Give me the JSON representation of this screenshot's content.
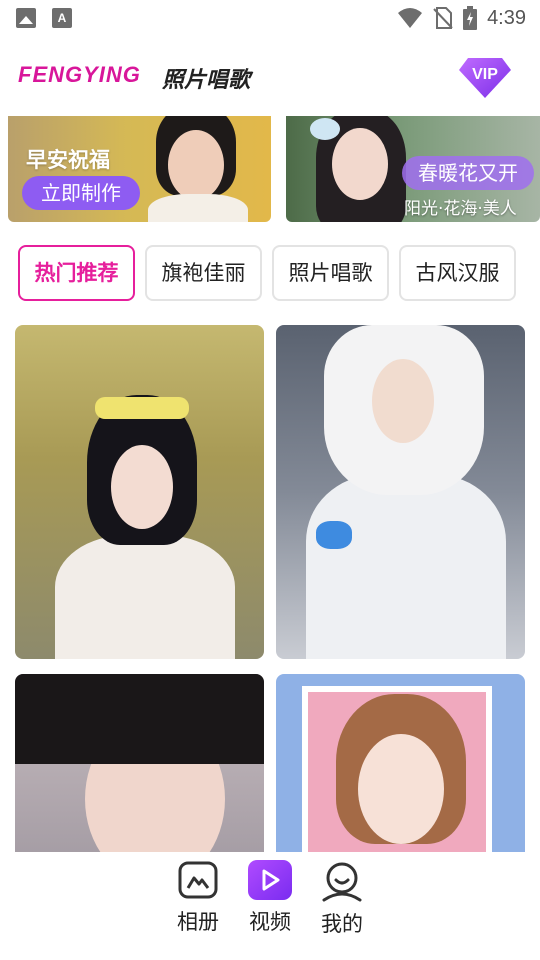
{
  "status_bar": {
    "time": "4:39",
    "left_icons": [
      "gallery-icon",
      "a-letter-icon"
    ],
    "right_icons": [
      "wifi-icon",
      "no-sim-icon",
      "battery-icon"
    ]
  },
  "header": {
    "brand": "FENGYING",
    "title": "照片唱歌",
    "vip_badge": "VIP",
    "brand_color": "#d8169a"
  },
  "banners": [
    {
      "title": "早安祝福",
      "button": "立即制作"
    },
    {
      "title": "春暖花又开",
      "subtitle": "阳光·花海·美人"
    }
  ],
  "tabs": [
    {
      "label": "热门推荐",
      "active": true
    },
    {
      "label": "旗袍佳丽",
      "active": false
    },
    {
      "label": "照片唱歌",
      "active": false
    },
    {
      "label": "古风汉服",
      "active": false
    }
  ],
  "accent_color": "#e61f9c",
  "grid": [
    {
      "kind": "portrait-hanfu-flowers"
    },
    {
      "kind": "portrait-white-fur-hat-butterflies"
    },
    {
      "kind": "portrait-dark-hair-closeup"
    },
    {
      "kind": "portrait-framed-brown-hair"
    }
  ],
  "bottom_nav": {
    "items": [
      {
        "label": "相册",
        "icon": "album-icon"
      },
      {
        "label": "视频",
        "icon": "play-icon",
        "active": true
      },
      {
        "label": "我的",
        "icon": "profile-icon"
      }
    ],
    "active_color": "#9c3cf6"
  }
}
